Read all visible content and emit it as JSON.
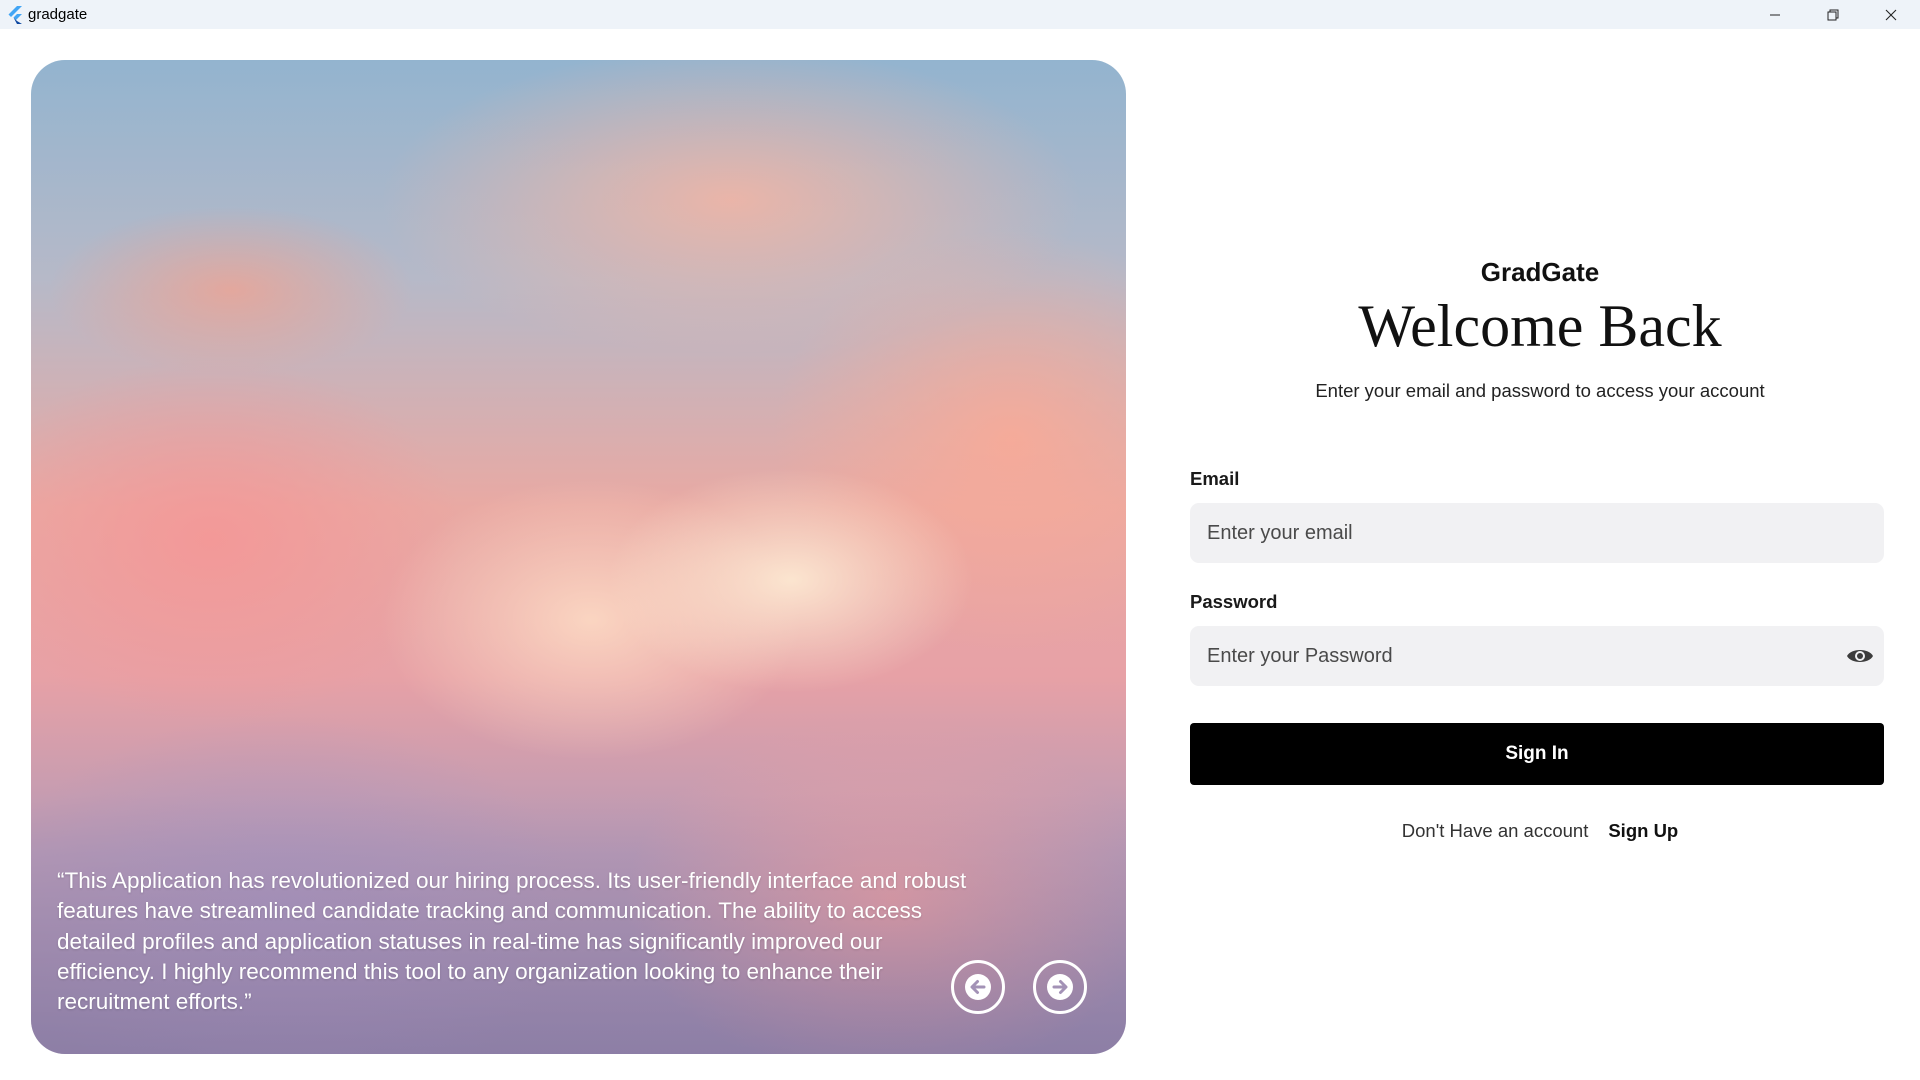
{
  "window": {
    "title": "gradgate",
    "logo_icon": "flutter-logo-icon",
    "controls": [
      "minimize-icon",
      "restore-icon",
      "close-icon"
    ]
  },
  "hero": {
    "quote": "“This Application has revolutionized our hiring process. Its user-friendly interface and robust features have streamlined candidate tracking and communication. The ability to access detailed profiles and application statuses in real-time has significantly improved our efficiency. I highly recommend this tool to any organization looking to enhance their recruitment efforts.”",
    "prev_icon": "arrow-left-circle-icon",
    "next_icon": "arrow-right-circle-icon"
  },
  "signin": {
    "brand": "GradGate",
    "heading": "Welcome Back",
    "subtitle": "Enter your email and password to access your account",
    "email_label": "Email",
    "email_placeholder": "Enter your email",
    "password_label": "Password",
    "password_placeholder": "Enter your Password",
    "password_toggle_icon": "eye-icon",
    "submit_label": "Sign In",
    "no_account_text": "Don't Have an account",
    "signup_label": "Sign Up"
  },
  "colors": {
    "titlebar_bg": "#eef3f9",
    "button_bg": "#000000",
    "field_bg": "#f1f1f3",
    "flutter_blue": "#42a5f5"
  }
}
